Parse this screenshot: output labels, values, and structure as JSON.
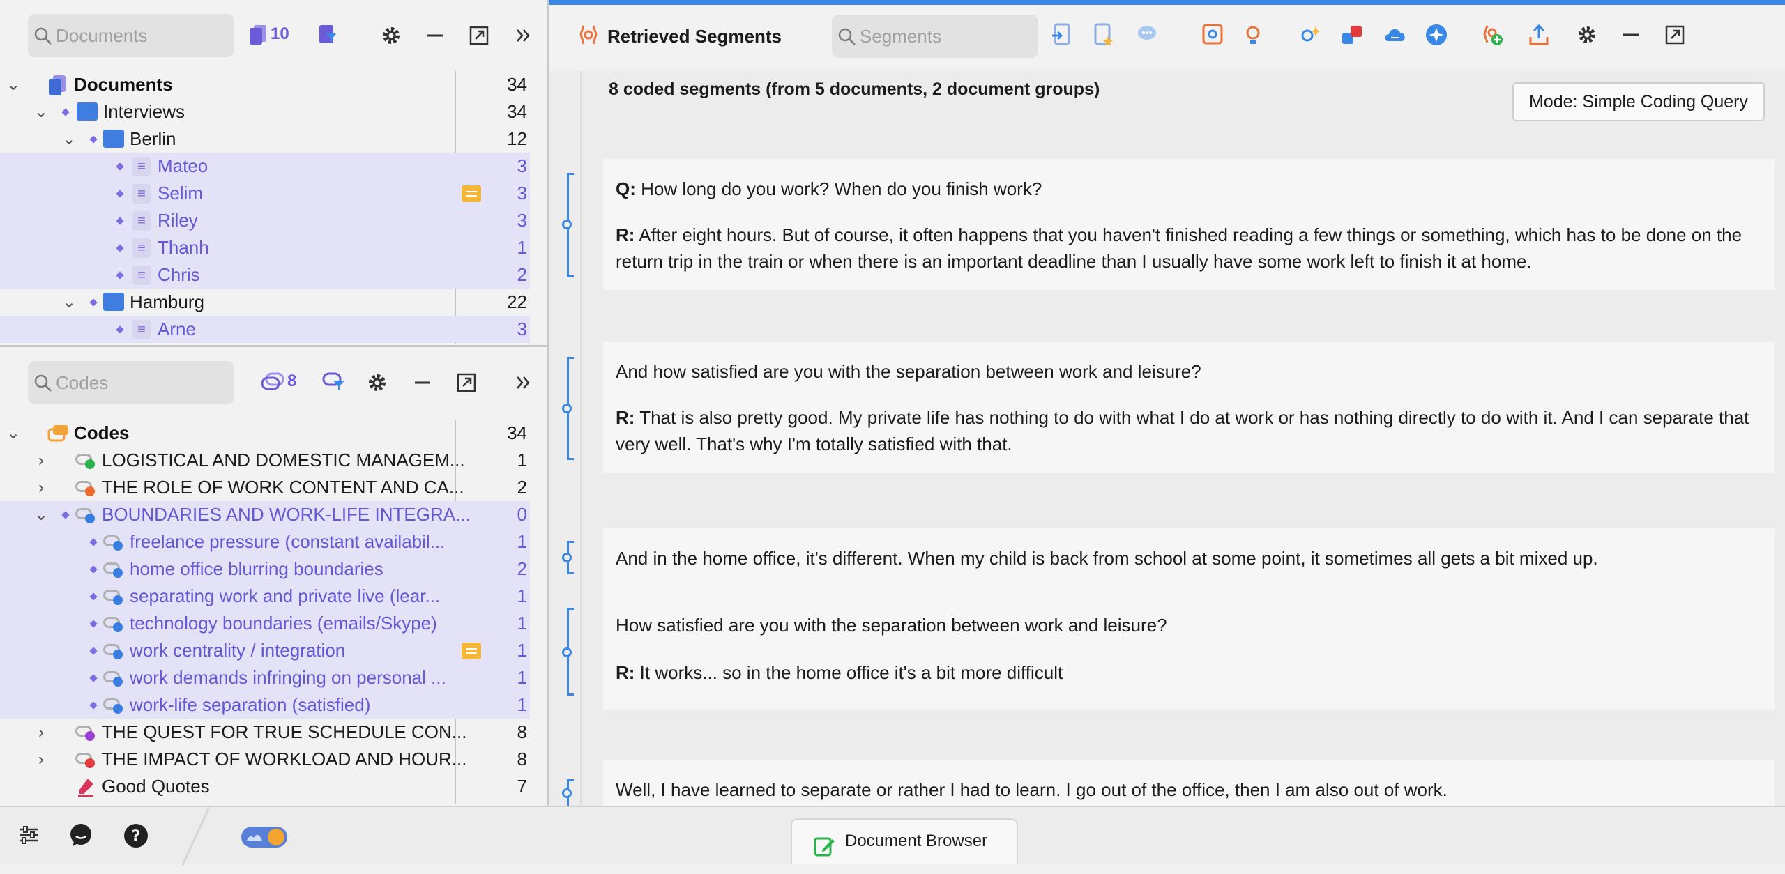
{
  "documents_panel": {
    "search_placeholder": "Documents",
    "doc_count": "10",
    "tree": [
      {
        "label": "Documents",
        "count": "34"
      },
      {
        "label": "Interviews",
        "count": "34"
      },
      {
        "label": "Berlin",
        "count": "12"
      },
      {
        "label": "Mateo",
        "count": "3"
      },
      {
        "label": "Selim",
        "count": "3"
      },
      {
        "label": "Riley",
        "count": "3"
      },
      {
        "label": "Thanh",
        "count": "1"
      },
      {
        "label": "Chris",
        "count": "2"
      },
      {
        "label": "Hamburg",
        "count": "22"
      },
      {
        "label": "Arne",
        "count": "3"
      }
    ]
  },
  "codes_panel": {
    "search_placeholder": "Codes",
    "code_count": "8",
    "tree": [
      {
        "label": "Codes",
        "count": "34"
      },
      {
        "label": "LOGISTICAL AND DOMESTIC MANAGEM...",
        "count": "1"
      },
      {
        "label": "THE ROLE OF WORK CONTENT AND CA...",
        "count": "2"
      },
      {
        "label": "BOUNDARIES AND WORK-LIFE INTEGRA...",
        "count": "0"
      },
      {
        "label": "freelance pressure (constant availabil...",
        "count": "1"
      },
      {
        "label": "home office blurring boundaries",
        "count": "2"
      },
      {
        "label": "separating work and private live (lear...",
        "count": "1"
      },
      {
        "label": "technology boundaries (emails/Skype)",
        "count": "1"
      },
      {
        "label": "work centrality / integration",
        "count": "1"
      },
      {
        "label": "work demands infringing on personal ...",
        "count": "1"
      },
      {
        "label": "work-life separation (satisfied)",
        "count": "1"
      },
      {
        "label": "THE QUEST FOR TRUE SCHEDULE CON...",
        "count": "8"
      },
      {
        "label": "THE IMPACT OF WORKLOAD AND HOUR...",
        "count": "8"
      },
      {
        "label": "Good Quotes",
        "count": "7"
      }
    ]
  },
  "retrieved": {
    "title": "Retrieved Segments",
    "search_placeholder": "Segments",
    "summary": "8 coded segments (from 5 documents, 2 document groups)",
    "mode_label": "Mode: Simple Coding Query",
    "segments": [
      {
        "p1_bold": "Q:",
        "p1": " How long do you work? When do you finish work?",
        "p2_bold": "R:",
        "p2": " After eight hours. But of course, it often happens that you haven't finished reading a few things or something, which has to be done on the return trip in the train or when there is an important deadline than I usually have some work left to finish it at home."
      },
      {
        "p1": "And how satisfied are you with the separation between work and leisure?",
        "p2_bold": "R:",
        "p2": " That is also pretty good. My private life has nothing to do with what I do at work or has nothing directly to do with it. And I can separate that very well. That's why I'm totally satisfied with that."
      },
      {
        "p1": "And in the home office, it's different. When my child is back from school at some point, it sometimes all gets a bit mixed up.",
        "p2": "How satisfied are you with the separation between work and leisure?",
        "p3_bold": "R:",
        "p3": " It works... so in the home office it's a bit more difficult"
      },
      {
        "p1": "Well, I have learned to separate or rather I had to learn. I go out of the office, then I am also out of work."
      }
    ]
  },
  "bottom": {
    "doc_browser_label": "Document Browser"
  },
  "colors": {
    "accent": "#3a88e6",
    "selection": "#e4e2f6",
    "selected_text": "#6657d2",
    "memo": "#f4b73a"
  }
}
